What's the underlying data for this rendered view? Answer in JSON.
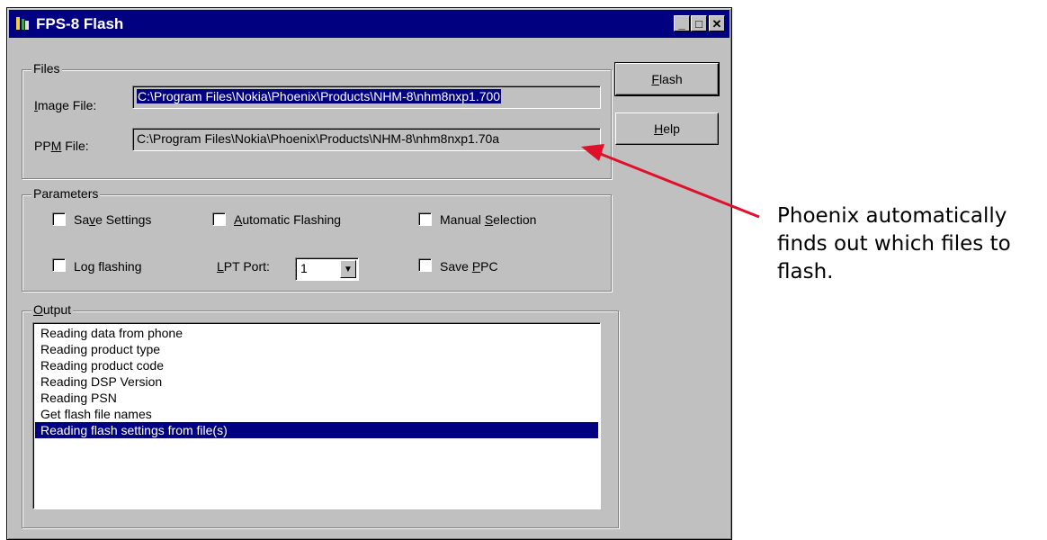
{
  "window": {
    "title": "FPS-8 Flash",
    "buttons": {
      "minimize": "_",
      "maximize": "□",
      "close": "✕"
    }
  },
  "files": {
    "group_label": "Files",
    "image_label_prefix": "",
    "image_label_u": "I",
    "image_label_rest": "mage File:",
    "image_value": "C:\\Program Files\\Nokia\\Phoenix\\Products\\NHM-8\\nhm8nxp1.700",
    "ppm_label_a": "PP",
    "ppm_label_u": "M",
    "ppm_label_b": " File:",
    "ppm_value": "C:\\Program Files\\Nokia\\Phoenix\\Products\\NHM-8\\nhm8nxp1.70a"
  },
  "actions": {
    "flash_u": "F",
    "flash_rest": "lash",
    "help_u": "H",
    "help_rest": "elp"
  },
  "parameters": {
    "group_label": "Parameters",
    "save_settings_a": "Sa",
    "save_settings_u": "v",
    "save_settings_b": "e Settings",
    "automatic_flashing_u": "A",
    "automatic_flashing_b": "utomatic Flashing",
    "manual_selection_a": "Manual ",
    "manual_selection_u": "S",
    "manual_selection_b": "election",
    "log_flashing": "Log flashing",
    "lpt_port_u": "L",
    "lpt_port_b": "PT Port:",
    "lpt_port_value": "1",
    "save_ppc_a": "Save ",
    "save_ppc_u": "P",
    "save_ppc_b": "PC"
  },
  "output": {
    "group_label_u": "O",
    "group_label_b": "utput",
    "items": [
      "Reading data from phone",
      "Reading product type",
      "Reading product code",
      "Reading DSP Version",
      "Reading PSN",
      "Get flash file names",
      "Reading flash settings from file(s)"
    ]
  },
  "annotation": {
    "text": "Phoenix automatically finds out which files to flash.",
    "arrow_color": "#e0102a"
  }
}
